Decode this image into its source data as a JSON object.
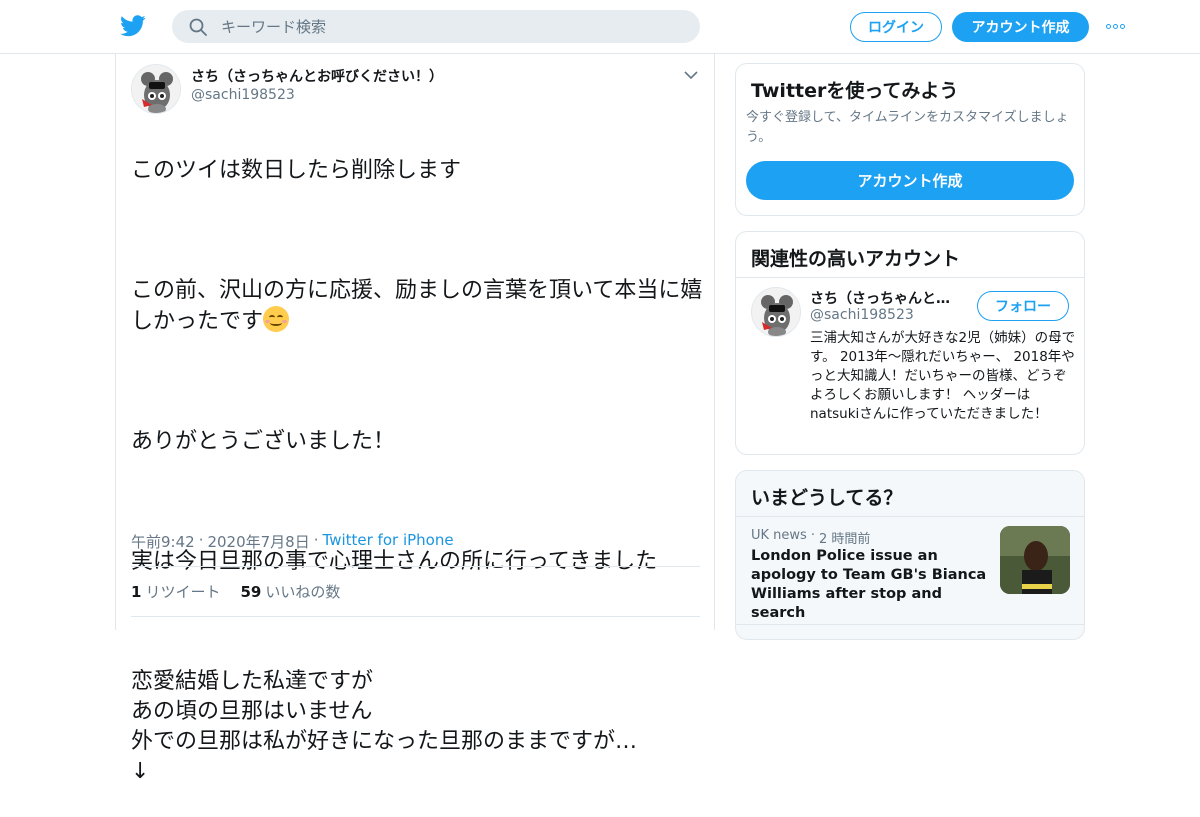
{
  "header": {
    "search_placeholder": "キーワード検索",
    "login_label": "ログイン",
    "signup_label": "アカウント作成"
  },
  "tweet": {
    "author_name": "さち（さっちゃんとお呼びください！）",
    "author_handle": "@sachi198523",
    "line1": "このツイは数日したら削除します",
    "line2": "この前、沢山の方に応援、励ましの言葉を頂いて本当に嬉しかったです",
    "line3": "ありがとうございました！",
    "line4": "実は今日旦那の事で心理士さんの所に行ってきました",
    "line5": "恋愛結婚した私達ですが\nあの頃の旦那はいません\n外での旦那は私が好きになった旦那のままですが…\n↓",
    "time": "午前9:42",
    "date": "2020年7月8日",
    "source": "Twitter for iPhone",
    "retweet_count": "1",
    "retweet_label": "リツイート",
    "like_count": "59",
    "like_label": "いいねの数"
  },
  "signup_card": {
    "title": "Twitterを使ってみよう",
    "subtitle": "今すぐ登録して、タイムラインをカスタマイズしましょう。",
    "button": "アカウント作成"
  },
  "related_card": {
    "title": "関連性の高いアカウント",
    "account_name": "さち（さっちゃんとお呼びください！）",
    "account_handle": "@sachi198523",
    "follow_label": "フォロー",
    "bio": "三浦大知さんが大好きな2児（姉妹）の母です。 2013年〜隠れだいちゃー、 2018年やっと大知識人！だいちゃーの皆様、どうぞよろしくお願いします！ ヘッダーはnatsukiさんに作っていただきました！"
  },
  "trends_card": {
    "title": "いまどうしてる？",
    "source": "UK news",
    "time": "2 時間前",
    "headline": "London Police issue an apology to Team GB's Bianca Williams after stop and search"
  },
  "colors": {
    "accent": "#1da1f2",
    "text": "#14171a",
    "muted": "#657786"
  }
}
